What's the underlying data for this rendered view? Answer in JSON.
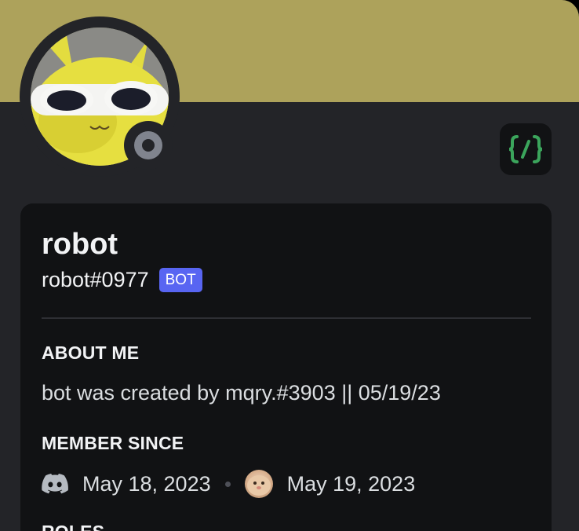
{
  "profile": {
    "display_name": "robot",
    "username": "robot#0977",
    "bot_tag": "BOT",
    "banner_color": "#ADA25B",
    "status": "offline",
    "avatar_icon": "pikachu-sunglasses-avatar",
    "badge_icon": "active-developer-icon"
  },
  "about": {
    "title": "ABOUT ME",
    "text": "bot was created by mqry.#3903 || 05/19/23"
  },
  "member_since": {
    "title": "MEMBER SINCE",
    "discord_date": "May 18, 2023",
    "server_date": "May 19, 2023",
    "discord_icon": "discord-logo-icon",
    "server_icon": "server-avatar-icon"
  },
  "roles": {
    "title": "ROLES"
  }
}
